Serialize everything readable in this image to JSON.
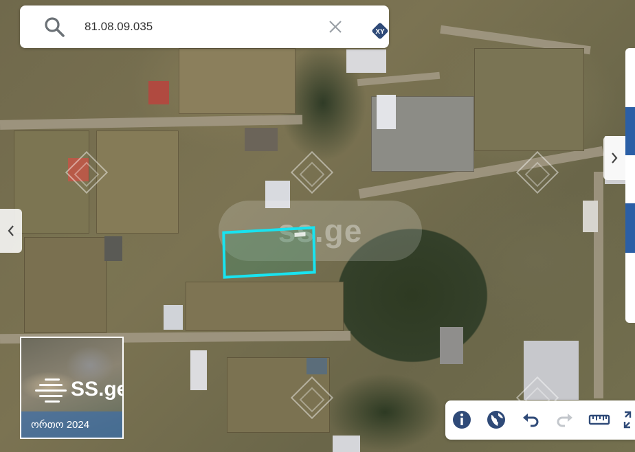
{
  "search": {
    "value": "81.08.09.035"
  },
  "map": {
    "watermark": "ss.ge",
    "parcel_color": "#19e3f0"
  },
  "basemap": {
    "brand": "SS.ge",
    "label": "ორთო 2024"
  },
  "icons": {
    "search": "search-icon",
    "clear": "close-icon",
    "xy": "xy-coordinates-icon",
    "info": "info-icon",
    "globe": "globe-icon",
    "undo": "undo-icon",
    "redo": "redo-icon",
    "ruler": "ruler-icon",
    "expand": "expand-icon",
    "left": "chevron-left-icon",
    "right": "chevron-right-icon"
  },
  "colors": {
    "accent": "#2b5fa6",
    "parcel": "#19e3f0",
    "icon": "#2f4a78"
  }
}
